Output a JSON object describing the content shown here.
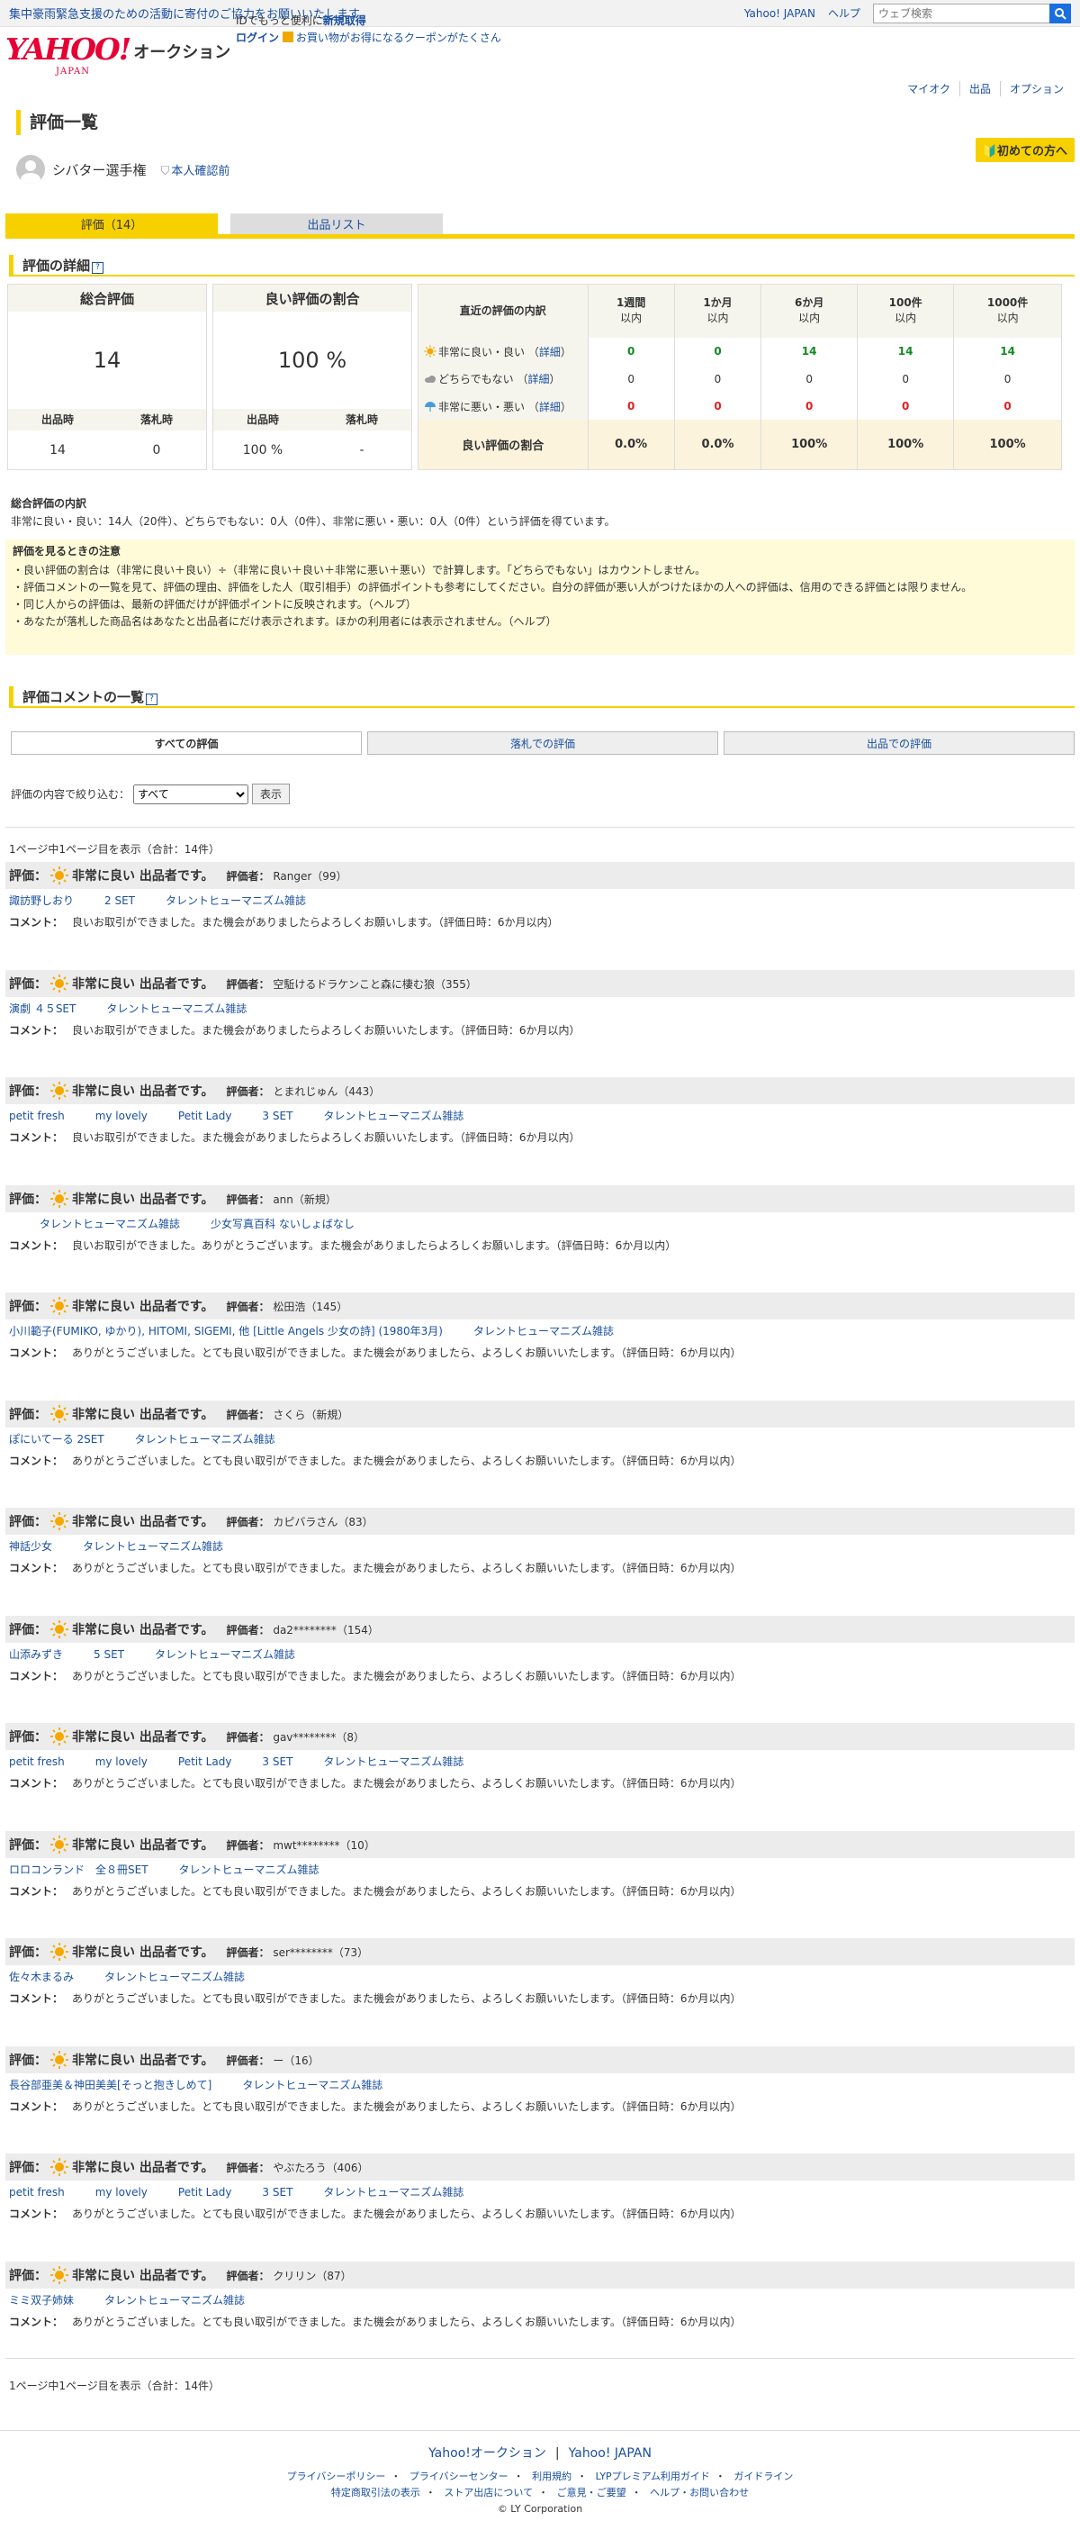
{
  "topbar": {
    "notice": "集中豪雨緊急支援のための活動に寄付のご協力をお願いいたします",
    "yahoo_japan": "Yahoo! JAPAN",
    "help": "ヘルプ",
    "search_placeholder": "ウェブ検索"
  },
  "header": {
    "logo_yahoo": "YAHOO!",
    "logo_japan": "JAPAN",
    "logo_auction": "オークション",
    "promo_line1_prefix": "IDでもっと便利に",
    "promo_line1_link": "新規取得",
    "promo_line2_login": "ログイン",
    "promo_line2_text": "お買い物がお得になるクーポンがたくさん"
  },
  "subnav": [
    "マイオク",
    "出品",
    "オプション"
  ],
  "page_title": "評価一覧",
  "beginner_button": "初めての方へ",
  "user": {
    "name": "シバター選手権",
    "verified": "本人確認前"
  },
  "tabs": [
    {
      "label": "評価（14）"
    },
    {
      "label": "出品リスト"
    }
  ],
  "detail": {
    "section_title": "評価の詳細",
    "total": {
      "title": "総合評価",
      "value": "14",
      "sub_labels": [
        "出品時",
        "落札時"
      ],
      "sub_values": [
        "14",
        "0"
      ]
    },
    "ratio": {
      "title": "良い評価の割合",
      "value": "100 %",
      "sub_labels": [
        "出品時",
        "落札時"
      ],
      "sub_values": [
        "100 %",
        "-"
      ]
    },
    "recent": {
      "head_label": "直近の評価の内訳",
      "periods": [
        {
          "top": "1週間",
          "bottom": "以内"
        },
        {
          "top": "1か月",
          "bottom": "以内"
        },
        {
          "top": "6か月",
          "bottom": "以内"
        },
        {
          "top": "100件",
          "bottom": "以内"
        },
        {
          "top": "1000件",
          "bottom": "以内"
        }
      ],
      "rows": [
        {
          "label": "非常に良い・良い",
          "detail": "詳細",
          "values": [
            "0",
            "0",
            "14",
            "14",
            "14"
          ],
          "icon": "sun-icon"
        },
        {
          "label": "どちらでもない",
          "detail": "詳細",
          "values": [
            "0",
            "0",
            "0",
            "0",
            "0"
          ],
          "icon": "cloud-icon"
        },
        {
          "label": "非常に悪い・悪い",
          "detail": "詳細",
          "values": [
            "0",
            "0",
            "0",
            "0",
            "0"
          ],
          "icon": "umbrella-icon"
        }
      ],
      "ratio_label": "良い評価の割合",
      "ratio_values": [
        "0.0%",
        "0.0%",
        "100%",
        "100%",
        "100%"
      ]
    }
  },
  "breakdown": {
    "title": "総合評価の内訳",
    "text": "非常に良い・良い：14人（20件）、どちらでもない：0人（0件）、非常に悪い・悪い：0人（0件）という評価を得ています。"
  },
  "notes": {
    "title": "評価を見るときの注意",
    "items": [
      "・良い評価の割合は（非常に良い＋良い）÷（非常に良い＋良い＋非常に悪い＋悪い）で計算します。「どちらでもない」はカウントしません。",
      "・評価コメントの一覧を見て、評価の理由、評価をした人（取引相手）の評価ポイントも参考にしてください。自分の評価が悪い人がつけたほかの人への評価は、信用のできる評価とは限りません。",
      "・同じ人からの評価は、最新の評価だけが評価ポイントに反映されます。（ヘルプ）",
      "・あなたが落札した商品名はあなたと出品者にだけ表示されます。ほかの利用者には表示されません。（ヘルプ）"
    ]
  },
  "comments": {
    "section_title": "評価コメントの一覧",
    "filter_tabs": [
      "すべての評価",
      "落札での評価",
      "出品での評価"
    ],
    "filter_label": "評価の内容で絞り込む：",
    "filter_selected": "すべて",
    "filter_button": "表示",
    "page_info": "1ページ中1ページ目を表示（合計：14件）",
    "rating_label": "評価：",
    "rating_text": "非常に良い 出品者です。",
    "rater_label": "評価者：",
    "comment_label": "コメント：",
    "items": [
      {
        "rater": "Ranger",
        "score": "（99）",
        "links": [
          "諏訪野しおり",
          "2 SET",
          "タレントヒューマニズム雑誌"
        ],
        "comment": "良いお取引ができました。また機会がありましたらよろしくお願いします。（評価日時：6か月以内）"
      },
      {
        "rater": "空駈けるドラケンこと森に棲む狼",
        "score": "（355）",
        "links": [
          "演劇 ４５SET",
          "タレントヒューマニズム雑誌"
        ],
        "comment": "良いお取引ができました。また機会がありましたらよろしくお願いいたします。（評価日時：6か月以内）"
      },
      {
        "rater": "とまれじゅん",
        "score": "（443）",
        "links": [
          "petit fresh",
          "my lovely",
          "Petit Lady",
          "3 SET",
          "タレントヒューマニズム雑誌"
        ],
        "comment": "良いお取引ができました。また機会がありましたらよろしくお願いいたします。（評価日時：6か月以内）"
      },
      {
        "rater": "ann",
        "score": "（新規）",
        "links": [
          "",
          "タレントヒューマニズム雑誌",
          "少女写真百科 ないしょばなし"
        ],
        "comment": "良いお取引ができました。ありがとうございます。また機会がありましたらよろしくお願いします。（評価日時：6か月以内）"
      },
      {
        "rater": "松田浩",
        "score": "（145）",
        "links": [
          "小川範子(FUMIKO, ゆかり), HITOMI, SIGEMI, 他 [Little Angels 少女の詩] (1980年3月)",
          "タレントヒューマニズム雑誌"
        ],
        "comment": "ありがとうございました。とても良い取引ができました。また機会がありましたら、よろしくお願いいたします。（評価日時：6か月以内）"
      },
      {
        "rater": "さくら",
        "score": "（新規）",
        "links": [
          "ぽにいてーる 2SET",
          "タレントヒューマニズム雑誌"
        ],
        "comment": "ありがとうございました。とても良い取引ができました。また機会がありましたら、よろしくお願いいたします。（評価日時：6か月以内）"
      },
      {
        "rater": "カピバラさん",
        "score": "（83）",
        "links": [
          "神話少女",
          "タレントヒューマニズム雑誌"
        ],
        "comment": "ありがとうございました。とても良い取引ができました。また機会がありましたら、よろしくお願いいたします。（評価日時：6か月以内）"
      },
      {
        "rater": "da2********",
        "score": "（154）",
        "links": [
          "山添みずき",
          "5 SET",
          "タレントヒューマニズム雑誌"
        ],
        "comment": "ありがとうございました。とても良い取引ができました。また機会がありましたら、よろしくお願いいたします。（評価日時：6か月以内）"
      },
      {
        "rater": "gav********",
        "score": "（8）",
        "links": [
          "petit fresh",
          "my lovely",
          "Petit Lady",
          "3 SET",
          "タレントヒューマニズム雑誌"
        ],
        "comment": "ありがとうございました。とても良い取引ができました。また機会がありましたら、よろしくお願いいたします。（評価日時：6か月以内）"
      },
      {
        "rater": "mwt********",
        "score": "（10）",
        "links": [
          "ロロコンランド　全８冊SET",
          "タレントヒューマニズム雑誌"
        ],
        "comment": "ありがとうございました。とても良い取引ができました。また機会がありましたら、よろしくお願いいたします。（評価日時：6か月以内）"
      },
      {
        "rater": "ser********",
        "score": "（73）",
        "links": [
          "佐々木まるみ",
          "タレントヒューマニズム雑誌"
        ],
        "comment": "ありがとうございました。とても良い取引ができました。また機会がありましたら、よろしくお願いいたします。（評価日時：6か月以内）"
      },
      {
        "rater": "ー",
        "score": "（16）",
        "links": [
          "長谷部亜美＆神田美美[そっと抱きしめて]",
          "タレントヒューマニズム雑誌"
        ],
        "comment": "ありがとうございました。とても良い取引ができました。また機会がありましたら、よろしくお願いいたします。（評価日時：6か月以内）"
      },
      {
        "rater": "やぶたろう",
        "score": "（406）",
        "links": [
          "petit fresh",
          "my lovely",
          "Petit Lady",
          "3 SET",
          "タレントヒューマニズム雑誌"
        ],
        "comment": "ありがとうございました。とても良い取引ができました。また機会がありましたら、よろしくお願いいたします。（評価日時：6か月以内）"
      },
      {
        "rater": "クリリン",
        "score": "（87）",
        "links": [
          "ミミ双子姉妹",
          "タレントヒューマニズム雑誌"
        ],
        "comment": "ありがとうございました。とても良い取引ができました。また機会がありましたら、よろしくお願いいたします。（評価日時：6か月以内）"
      }
    ]
  },
  "footer": {
    "links": [
      "Yahoo!オークション",
      "Yahoo! JAPAN"
    ],
    "small_links_1": [
      "プライバシーポリシー",
      "プライバシーセンター",
      "利用規約",
      "LYPプレミアム利用ガイド",
      "ガイドライン"
    ],
    "small_links_2": [
      "特定商取引法の表示",
      "ストア出店について",
      "ご意見・ご要望",
      "ヘルプ・お問い合わせ"
    ],
    "copyright": "© LY Corporation"
  },
  "colors": {
    "accent": "#f7d000",
    "link": "#1a4fa0",
    "good": "#138a23",
    "bad": "#dd2222",
    "brand": "#e60033"
  }
}
